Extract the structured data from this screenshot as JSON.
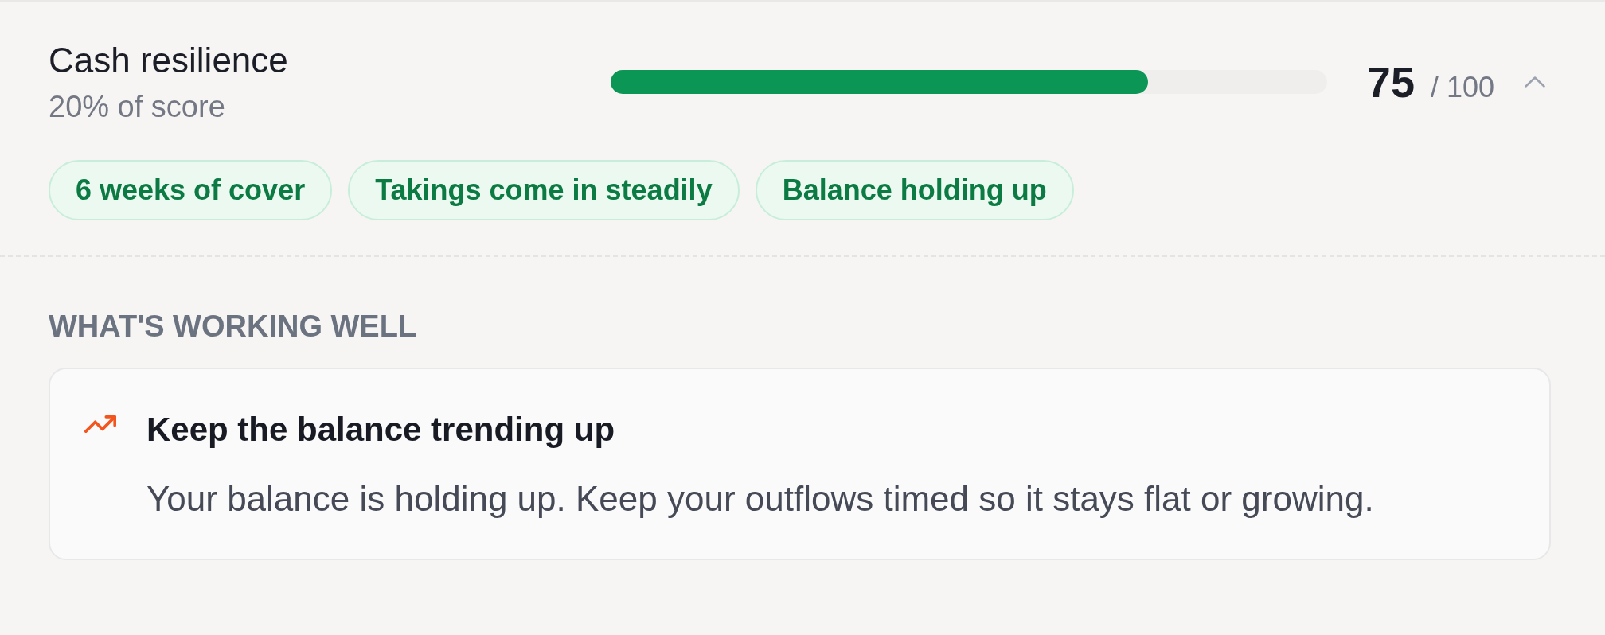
{
  "section": {
    "title": "Cash resilience",
    "weight": "20% of score",
    "level": 0.75,
    "score": "75",
    "max": "/ 100",
    "expanded": true
  },
  "highlights": [
    "6 weeks of cover",
    "Takings come in steadily",
    "Balance holding up"
  ],
  "working_well": {
    "heading": "WHAT'S WORKING WELL",
    "items": [
      {
        "title": "Keep the balance trending up",
        "body": "Your balance is holding up. Keep your outflows timed so it stays flat or growing."
      }
    ]
  }
}
